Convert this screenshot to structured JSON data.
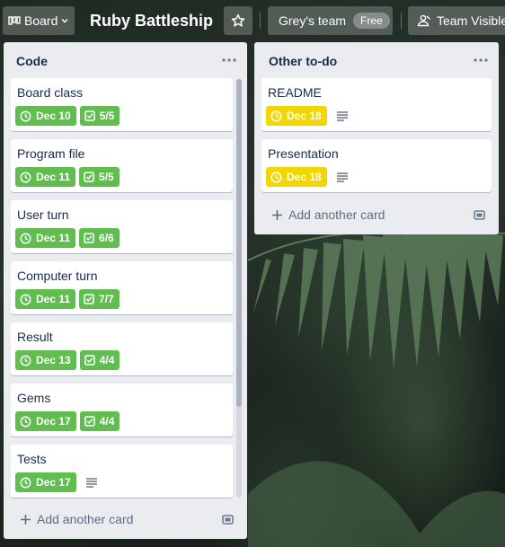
{
  "header": {
    "board_menu_label": "Board",
    "board_title": "Ruby Battleship",
    "team_label": "Grey's team",
    "team_plan_badge": "Free",
    "visibility_label": "Team Visible"
  },
  "lists": [
    {
      "title": "Code",
      "cards": [
        {
          "title": "Board class",
          "due": "Dec 10",
          "checklist": "5/5"
        },
        {
          "title": "Program file",
          "due": "Dec 11",
          "checklist": "5/5"
        },
        {
          "title": "User turn",
          "due": "Dec 11",
          "checklist": "6/6"
        },
        {
          "title": "Computer turn",
          "due": "Dec 11",
          "checklist": "7/7"
        },
        {
          "title": "Result",
          "due": "Dec 13",
          "checklist": "4/4"
        },
        {
          "title": "Gems",
          "due": "Dec 17",
          "checklist": "4/4"
        },
        {
          "title": "Tests",
          "due": "Dec 17"
        }
      ],
      "add_card_label": "Add another card"
    },
    {
      "title": "Other to-do",
      "cards": [
        {
          "title": "README",
          "due": "Dec 18"
        },
        {
          "title": "Presentation",
          "due": "Dec 18"
        }
      ],
      "add_card_label": "Add another card"
    }
  ],
  "colors": {
    "due_complete": "#61bd4f",
    "due_soon": "#f2d600",
    "list_background": "#ebecf0"
  },
  "icons": {
    "board_menu": "board-icon",
    "star": "star-icon",
    "visibility": "team-icon",
    "list_menu": "ellipsis-icon",
    "due": "clock-icon",
    "checklist": "checkbox-icon",
    "description": "description-icon",
    "add": "plus-icon",
    "template": "card-template-icon"
  }
}
